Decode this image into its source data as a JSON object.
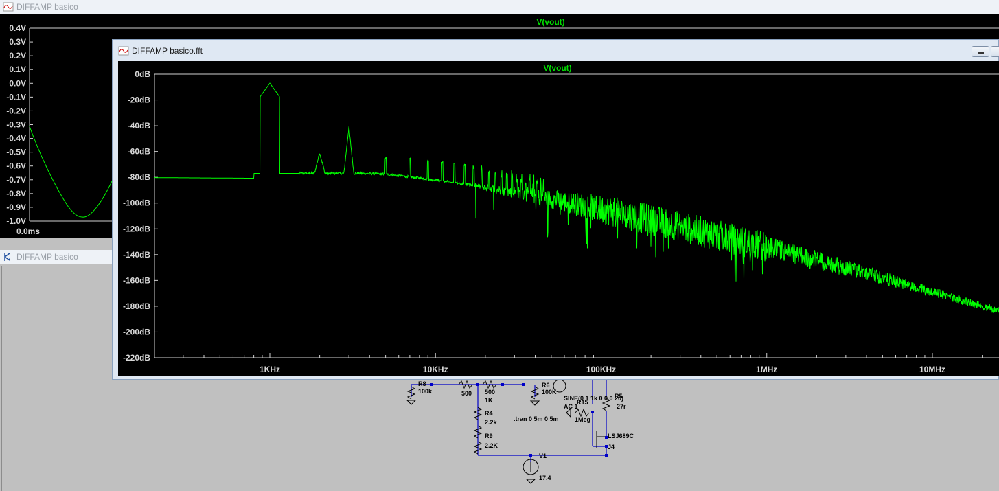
{
  "app": {
    "main_window_title": "DIFFAMP basico",
    "schematic_window_title": "DIFFAMP basico",
    "fft_window_title": "DIFFAMP basico.fft"
  },
  "transient_plot": {
    "trace_label": "V(vout)",
    "y_ticks": [
      "0.4V",
      "0.3V",
      "0.2V",
      "0.1V",
      "0.0V",
      "-0.1V",
      "-0.2V",
      "-0.3V",
      "-0.4V",
      "-0.5V",
      "-0.6V",
      "-0.7V",
      "-0.8V",
      "-0.9V",
      "-1.0V"
    ],
    "x_ticks": [
      "0.0ms"
    ]
  },
  "fft_plot": {
    "trace_label": "V(vout)",
    "y_ticks": [
      "0dB",
      "-20dB",
      "-40dB",
      "-60dB",
      "-80dB",
      "-100dB",
      "-120dB",
      "-140dB",
      "-160dB",
      "-180dB",
      "-200dB",
      "-220dB"
    ],
    "x_ticks": [
      "1KHz",
      "10KHz",
      "100KHz",
      "1MHz",
      "10MHz"
    ],
    "trace_color": "#00ff00"
  },
  "schematic": {
    "labels": {
      "r8": "R8",
      "r8_val": "100k",
      "r500": "500",
      "r500b": "500",
      "r_1k": "1K",
      "r4": "R4",
      "r4_val": "2.2k",
      "r9": "R9",
      "r9_val": "2.2K",
      "r6_val": "100K",
      "r6": "R6",
      "sine": "SINE(0 1 1k 0 0 0 20)",
      "ac": "AC 1",
      "r15": "R15",
      "r15_val": "1Meg",
      "r5": "R5",
      "r5_val": "27r",
      "tran": ".tran 0 5m 0 5m",
      "jfet": "LSJ689C",
      "j4": "J4",
      "v1": "V1",
      "v1_val": "17.4"
    },
    "wire_color": "#0000c8",
    "component_color": "#000000"
  }
}
